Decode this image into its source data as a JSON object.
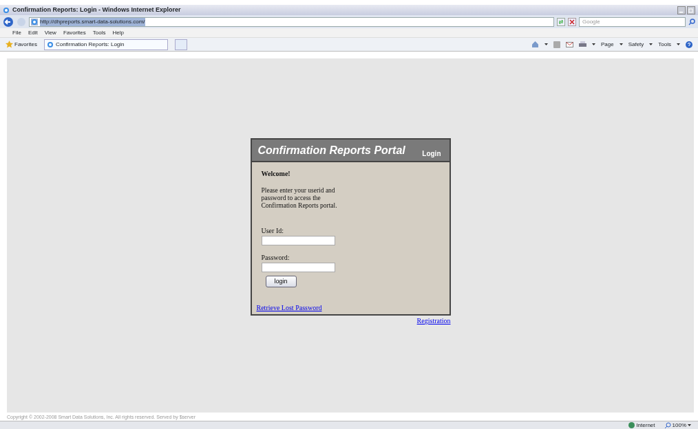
{
  "window": {
    "title": "Confirmation Reports: Login - Windows Internet Explorer"
  },
  "address_bar": {
    "url": "http://dhpreports.smart-data-solutions.com/"
  },
  "search": {
    "placeholder": "Google"
  },
  "menu": [
    "File",
    "Edit",
    "View",
    "Favorites",
    "Tools",
    "Help"
  ],
  "favorites_bar": {
    "label": "Favorites",
    "tabs": [
      {
        "title": "Confirmation Reports: Login",
        "selected": true
      }
    ]
  },
  "command_bar": [
    "Page",
    "Safety",
    "Tools"
  ],
  "portal": {
    "title": "Confirmation Reports Portal",
    "section": "Login",
    "welcome": "Welcome!",
    "instructions": "Please enter your userid and password to access the Confirmation Reports portal.",
    "fields": [
      {
        "label": "User Id:"
      },
      {
        "label": "Password:"
      }
    ],
    "button": "login",
    "lost_password_link": "Retrieve Lost Password",
    "registration_link": "Registration"
  },
  "footer": "Copyright © 2002-2008 Smart Data Solutions, Inc. All rights reserved. Served by $server",
  "status_bar": {
    "zone": "Internet",
    "zoom": "100%"
  }
}
